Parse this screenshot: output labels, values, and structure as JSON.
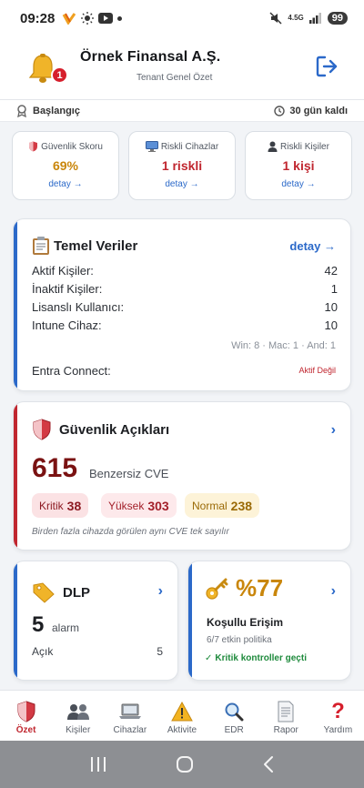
{
  "status_bar": {
    "time": "09:28",
    "battery": "99",
    "network": "4.5G"
  },
  "header": {
    "company": "Örnek Finansal A.Ş.",
    "subtitle": "Tenant Genel Özet",
    "notification_count": "1"
  },
  "info_row": {
    "left": "Başlangıç",
    "right": "30 gün kaldı"
  },
  "summary_cards": [
    {
      "label": "Güvenlik Skoru",
      "value": "69%",
      "link": "detay →",
      "value_color": "#c9860b"
    },
    {
      "label": "Riskli Cihazlar",
      "value": "1 riskli",
      "link": "detay →",
      "value_color": "#c0262f"
    },
    {
      "label": "Riskli Kişiler",
      "value": "1 kişi",
      "link": "detay →",
      "value_color": "#c0262f"
    }
  ],
  "temel": {
    "title": "Temel Veriler",
    "link": "detay →",
    "rows": [
      {
        "label": "Aktif Kişiler:",
        "value": "42"
      },
      {
        "label": "İnaktif Kişiler:",
        "value": "1"
      },
      {
        "label": "Lisanslı Kullanıcı:",
        "value": "10"
      },
      {
        "label": "Intune Cihaz:",
        "value": "10"
      }
    ],
    "os_breakdown": "Win: 8 · Mac: 1 · And: 1",
    "entra_label": "Entra Connect:",
    "entra_value": "Aktif Değil"
  },
  "guvenlik": {
    "title": "Güvenlik Açıkları",
    "count": "615",
    "count_label": "Benzersiz CVE",
    "pills": [
      {
        "label": "Kritik",
        "value": "38"
      },
      {
        "label": "Yüksek",
        "value": "303"
      },
      {
        "label": "Normal",
        "value": "238"
      }
    ],
    "note": "Birden fazla cihazda görülen aynı CVE tek sayılır"
  },
  "dlp": {
    "title": "DLP",
    "count": "5",
    "count_label": "alarm",
    "open_label": "Açık",
    "open_value": "5"
  },
  "kosullu": {
    "percent": "%77",
    "title": "Koşullu Erişim",
    "sub": "6/7 etkin politika",
    "ok": "Kritik kontroller geçti"
  },
  "bottom_nav": [
    {
      "label": "Özet",
      "icon": "shield-icon"
    },
    {
      "label": "Kişiler",
      "icon": "people-icon"
    },
    {
      "label": "Cihazlar",
      "icon": "laptop-icon"
    },
    {
      "label": "Aktivite",
      "icon": "warning-icon"
    },
    {
      "label": "EDR",
      "icon": "magnifier-icon"
    },
    {
      "label": "Rapor",
      "icon": "document-icon"
    },
    {
      "label": "Yardım",
      "icon": "question-icon"
    }
  ],
  "colors": {
    "accent_blue": "#2b69c9",
    "danger_red": "#c0262f",
    "warning_amber": "#c9860b",
    "ok_green": "#1e8a3c"
  }
}
